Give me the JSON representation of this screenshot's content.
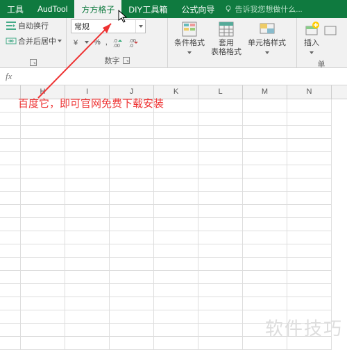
{
  "tabs": {
    "t0": "工具",
    "t1": "AudTool",
    "t2": "方方格子",
    "t3": "DIY工具箱",
    "t4": "公式向导",
    "tellme": "告诉我您想做什么..."
  },
  "ribbon": {
    "wrap": "自动换行",
    "merge": "合并后居中",
    "numfmt": "常规",
    "pct": "%",
    "comma": ",",
    "dec_inc": ".0",
    "dec_dec": ".00",
    "group_number": "数字",
    "cond": "条件格式",
    "table": "套用\n表格格式",
    "cell": "单元格样式",
    "group_style": "",
    "insert": "插入",
    "group_cells": "单"
  },
  "fx": "fx",
  "cols": [
    "",
    "H",
    "I",
    "J",
    "K",
    "L",
    "M",
    "N"
  ],
  "annotation": "百度它，即可官网免费下载安装",
  "watermark": "软件技巧"
}
